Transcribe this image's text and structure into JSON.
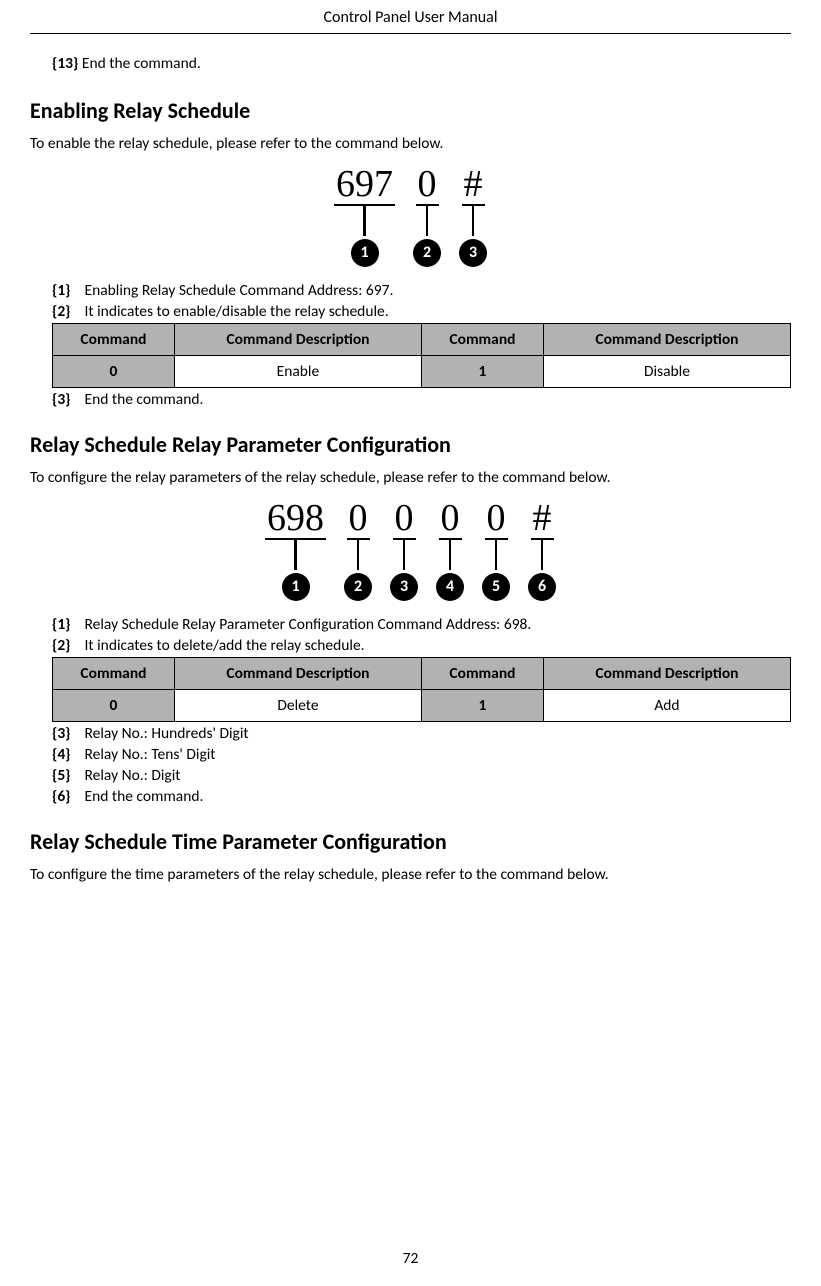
{
  "header": {
    "title": "Control Panel User Manual"
  },
  "note13": {
    "brace": "{13}",
    "text": "End the command."
  },
  "sec1": {
    "heading": "Enabling Relay Schedule",
    "intro": "To enable the relay schedule, please refer to the command below.",
    "diagram": {
      "parts": [
        {
          "val": "697",
          "num": "1"
        },
        {
          "val": "0",
          "num": "2"
        },
        {
          "val": "#",
          "num": "3"
        }
      ]
    },
    "defs": {
      "d1": {
        "brace": "{1}",
        "text": "Enabling Relay Schedule Command Address: 697."
      },
      "d2": {
        "brace": "{2}",
        "text": "It indicates to enable/disable the relay schedule."
      },
      "d3": {
        "brace": "{3}",
        "text": "End the command."
      }
    },
    "table": {
      "h1": "Command",
      "h2": "Command Description",
      "h3": "Command",
      "h4": "Command Description",
      "c1": "0",
      "c2": "Enable",
      "c3": "1",
      "c4": "Disable"
    }
  },
  "sec2": {
    "heading": "Relay Schedule Relay Parameter Configuration",
    "intro": "To configure the relay parameters of the relay schedule, please refer to the command below.",
    "diagram": {
      "parts": [
        {
          "val": "698",
          "num": "1"
        },
        {
          "val": "0",
          "num": "2"
        },
        {
          "val": "0",
          "num": "3"
        },
        {
          "val": "0",
          "num": "4"
        },
        {
          "val": "0",
          "num": "5"
        },
        {
          "val": "#",
          "num": "6"
        }
      ]
    },
    "defs": {
      "d1": {
        "brace": "{1}",
        "text": "Relay Schedule Relay Parameter Configuration Command Address: 698."
      },
      "d2": {
        "brace": "{2}",
        "text": "It indicates to delete/add the relay schedule."
      },
      "d3": {
        "brace": "{3}",
        "text": "Relay No.: Hundreds' Digit"
      },
      "d4": {
        "brace": "{4}",
        "text": "Relay No.: Tens' Digit"
      },
      "d5": {
        "brace": "{5}",
        "text": "Relay No.: Digit"
      },
      "d6": {
        "brace": "{6}",
        "text": "End the command."
      }
    },
    "table": {
      "h1": "Command",
      "h2": "Command Description",
      "h3": "Command",
      "h4": "Command Description",
      "c1": "0",
      "c2": "Delete",
      "c3": "1",
      "c4": "Add"
    }
  },
  "sec3": {
    "heading": "Relay Schedule Time Parameter Configuration",
    "intro": "To configure the time parameters of the relay schedule, please refer to the command below."
  },
  "footer": {
    "page": "72"
  }
}
